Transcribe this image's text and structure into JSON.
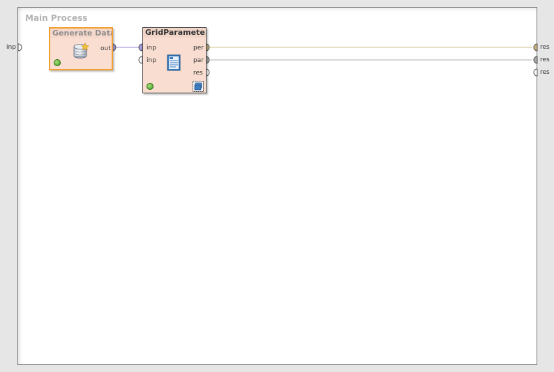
{
  "process": {
    "title": "Main Process"
  },
  "left_ports": [
    {
      "label": "inp"
    }
  ],
  "right_ports": [
    {
      "label": "res"
    },
    {
      "label": "res"
    },
    {
      "label": "res"
    }
  ],
  "operators": {
    "generate_data": {
      "title": "Generate Data",
      "out_port": "out",
      "icon": "database-icon"
    },
    "grid_parameter": {
      "title": "GridParamete...",
      "in_ports": [
        "inp",
        "inp"
      ],
      "out_ports": [
        "per",
        "par",
        "res"
      ],
      "icon": "document-icon",
      "subprocess_icon": "subprocess-icon"
    }
  },
  "colors": {
    "wire_data": "#9b87d6",
    "wire_performance": "#c8c08a",
    "wire_parameter": "#b0b0b0",
    "port_data": "#a79be0",
    "port_performance": "#c4b27a",
    "port_parameter": "#a8a8a8",
    "operator_fill": "#f9ddd0",
    "selection_border": "#f0a030"
  }
}
